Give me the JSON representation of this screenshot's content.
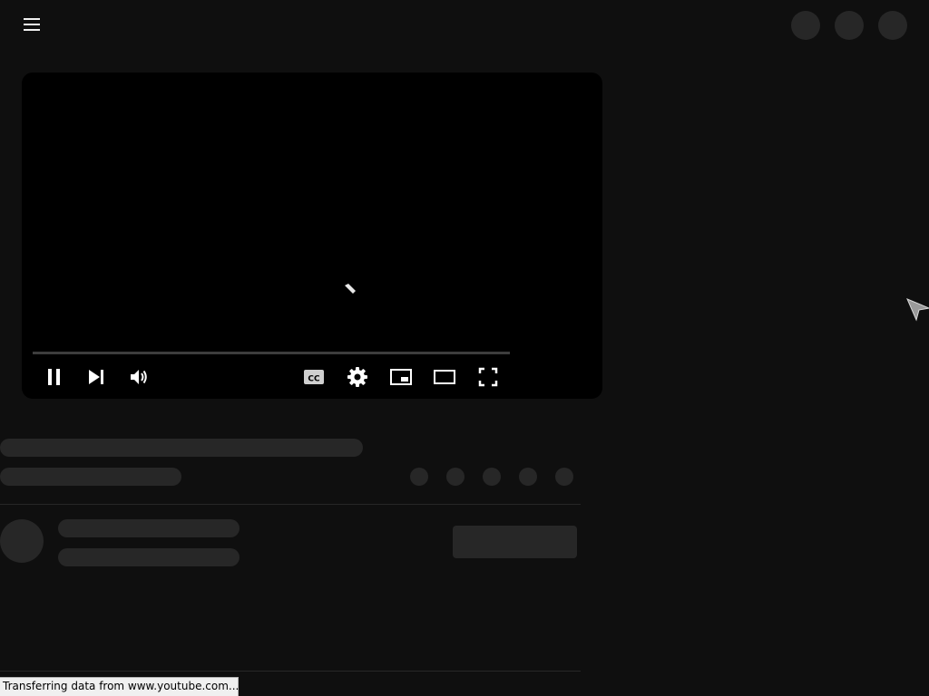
{
  "header": {
    "menu_icon": "hamburger-menu-icon",
    "right_placeholders": 3
  },
  "player": {
    "state": "loading",
    "progress_fraction": 0,
    "controls": [
      {
        "name": "pause-button",
        "icon": "pause-icon"
      },
      {
        "name": "next-button",
        "icon": "skip-next-icon"
      },
      {
        "name": "volume-button",
        "icon": "volume-icon"
      },
      {
        "name": "captions-button",
        "icon": "cc-icon"
      },
      {
        "name": "settings-button",
        "icon": "gear-icon"
      },
      {
        "name": "miniplayer-button",
        "icon": "miniplayer-icon"
      },
      {
        "name": "theater-mode-button",
        "icon": "theater-icon"
      },
      {
        "name": "fullscreen-button",
        "icon": "fullscreen-icon"
      }
    ],
    "cc_label": "CC"
  },
  "colors": {
    "background": "#0f0f0f",
    "placeholder": "#272727",
    "player_bg": "#000000",
    "control_icon": "#ffffff",
    "progress_track": "#3d3d3d"
  },
  "status_bar": {
    "text": "Transferring data from www.youtube.com..."
  }
}
